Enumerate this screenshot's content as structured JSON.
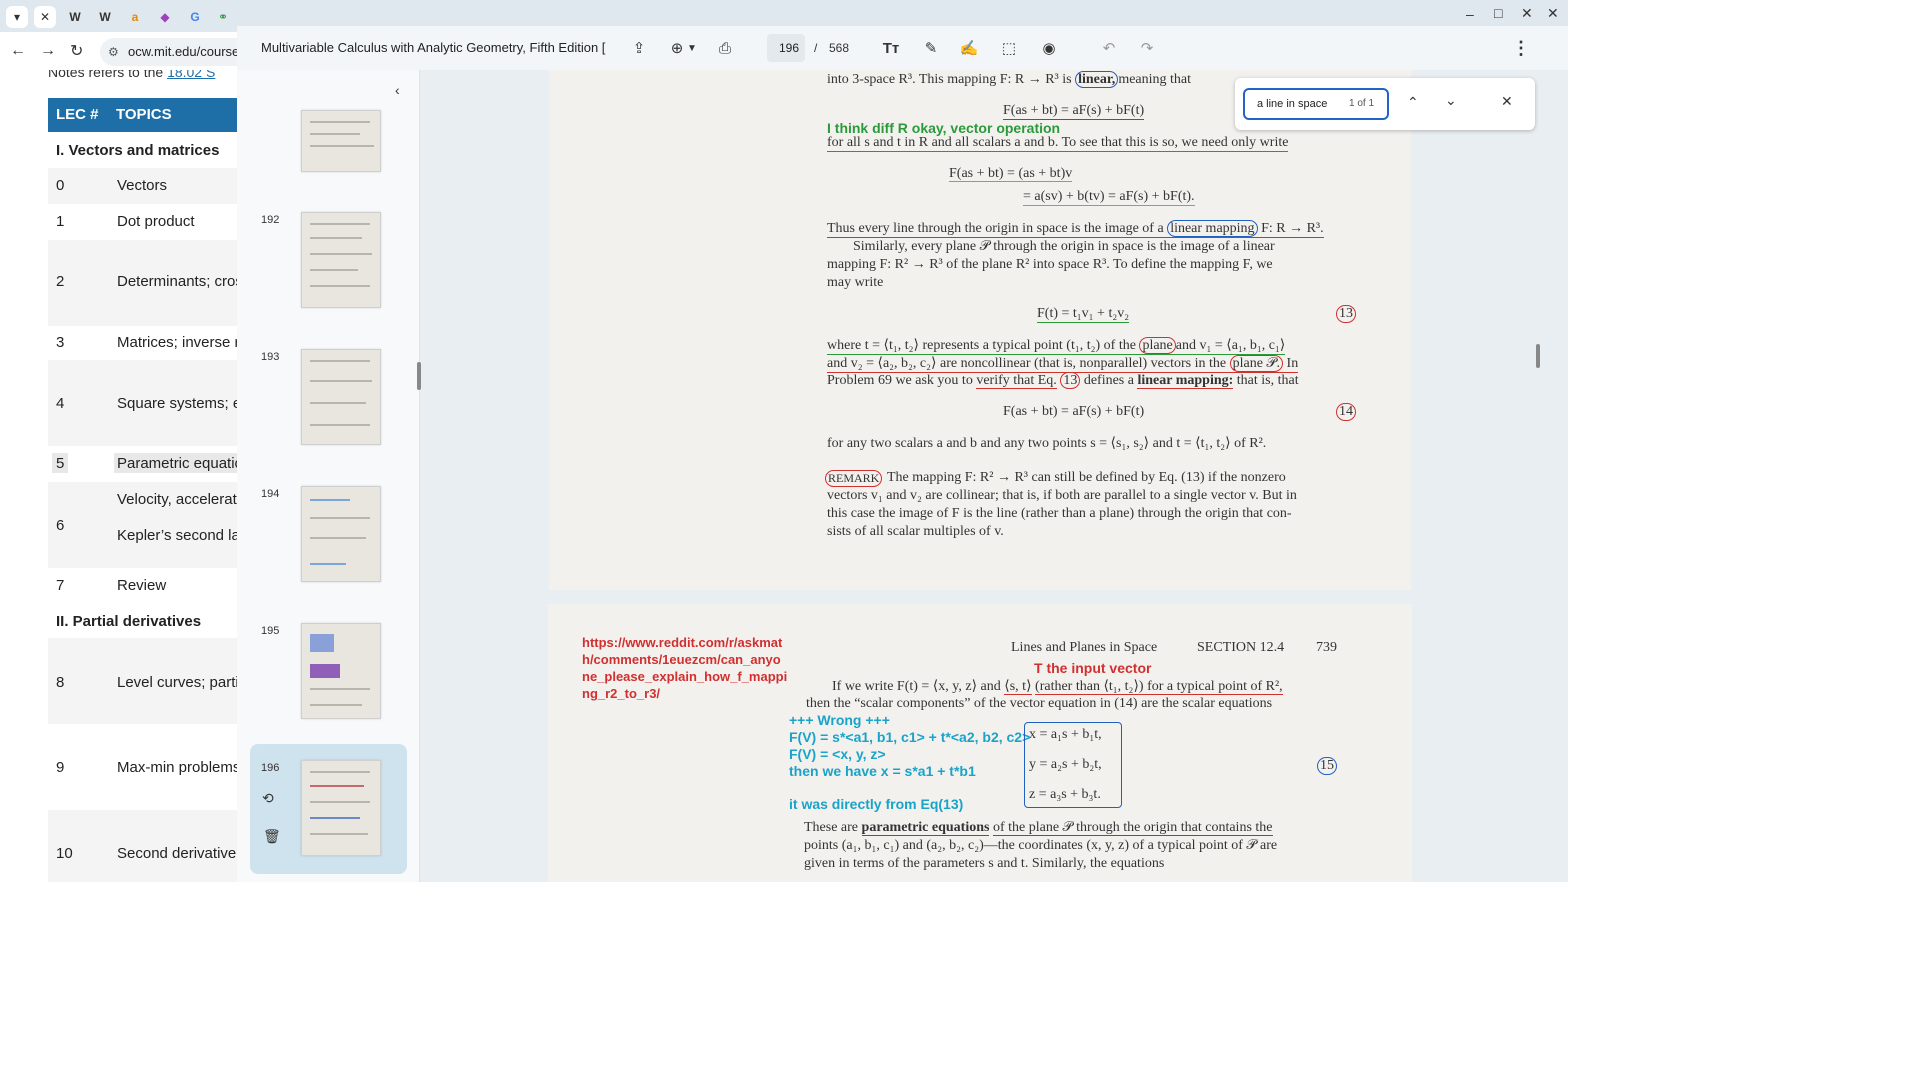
{
  "browser": {
    "tabs": [
      "▾",
      "✕",
      "W",
      "W",
      "a",
      "◆",
      "G",
      "⚭"
    ],
    "url": "ocw.mit.edu/courses...",
    "nav": {
      "back": "←",
      "forward": "→",
      "reload": "↻"
    }
  },
  "window_controls": {
    "min": "–",
    "max": "□",
    "close": "✕"
  },
  "webpage": {
    "note_prefix": "Notes  refers to the",
    "note_link": "18.02 S",
    "table_header": {
      "lec": "LEC #",
      "topics": "TOPICS"
    },
    "sections": [
      "I. Vectors and matrices",
      "II. Partial derivatives"
    ],
    "rows": [
      {
        "num": "0",
        "topic": "Vectors"
      },
      {
        "num": "1",
        "topic": "Dot product"
      },
      {
        "num": "2",
        "topic": "Determinants; cros"
      },
      {
        "num": "3",
        "topic": "Matrices; inverse r"
      },
      {
        "num": "4",
        "topic": "Square systems; e"
      },
      {
        "num": "5",
        "topic": "Parametric equatio"
      },
      {
        "num": "6",
        "topic": "Velocity, accelerati",
        "topic2": "Kepler’s second la"
      },
      {
        "num": "7",
        "topic": "Review"
      },
      {
        "num": "8",
        "topic": "Level curves; parti"
      },
      {
        "num": "9",
        "topic": "Max-min problems"
      },
      {
        "num": "10",
        "topic": "Second derivative"
      }
    ]
  },
  "pdf": {
    "title": "Multivariable Calculus with Analytic Geometry, Fifth Edition [",
    "page_current": "196",
    "page_sep": "/",
    "page_total": "568",
    "thumbnails": [
      "192",
      "193",
      "194",
      "195",
      "196"
    ],
    "find": {
      "query": "a line in space",
      "count": "1 of 1"
    }
  },
  "page1": {
    "l0": "into 3-space R³. This mapping F: R → R³ is",
    "l0_boxed": "linear,",
    "l0_end": "meaning that",
    "eq0": "F(as + bt) = aF(s) + bF(t)",
    "note1": "I think diff R okay, vector operation",
    "l1": "for all s and t in R and all scalars a and b. To see that this is so, we need only write",
    "eq1a": "F(as + bt) = (as + bt)v",
    "eq1b": "= a(sv) + b(tv) = aF(s) + bF(t).",
    "l2a": "Thus every line through the origin in space is the image of a",
    "l2_boxed": "linear mapping",
    "l2b": "F: R → R³.",
    "l3": "Similarly, every plane 𝒫 through the origin in space is the image of a linear",
    "l4": "mapping F: R² → R³ of the plane R² into space R³. To define the mapping F, we",
    "l5": "may write",
    "eq13": "F(t) = t₁v₁ + t₂v₂",
    "eq13_num": "13",
    "l6a": "where t = ⟨t₁, t₂⟩ represents a typical point (t₁, t₂) of the",
    "l6_circ": "plane",
    "l6b": "and v₁ = ⟨a₁, b₁, c₁⟩",
    "l7a": "and v₂ = ⟨a₂, b₂, c₂⟩ are noncollinear (that is, nonparallel) vectors in the",
    "l7_circ": "plane 𝒫.",
    "l7b": "In",
    "l8a": "Problem 69 we ask you to",
    "l8_verify": "verify that Eq.",
    "l8_circ": "13",
    "l8b": "defines a",
    "l8_bold": "linear mapping:",
    "l8c": "that is, that",
    "eq14": "F(as + bt) = aF(s) + bF(t)",
    "eq14_num": "14",
    "l9": "for any two scalars a and b and any two points s = ⟨s₁, s₂⟩ and t = ⟨t₁, t₂⟩ of R².",
    "remark": "REMARK",
    "r1": "The mapping F: R² → R³ can still be defined by Eq. (13) if the nonzero",
    "r2": "vectors v₁ and v₂ are collinear; that is, if both are parallel to a single vector v. But in",
    "r3": "this case the image of F is the line (rather than a plane) through the origin that con-",
    "r4": "sists of all scalar multiples of v."
  },
  "page2": {
    "link": [
      "https://www.reddit.com/r/askmat",
      "h/comments/1euezcm/can_anyo",
      "ne_please_explain_how_f_mappi",
      "ng_r2_to_r3/"
    ],
    "header_title": "Lines and Planes in Space",
    "header_section": "SECTION 12.4",
    "header_page": "739",
    "note_t": "T the input vector",
    "p1a": "If we write F(t) = ⟨x, y, z⟩ and",
    "p1_circ": "⟨s, t⟩",
    "p1b": "(rather than ⟨t₁, t₂⟩) for a typical point of R²,",
    "p2": "then the “scalar components” of the vector equation in (14) are the scalar equations",
    "wrong": [
      "+++ Wrong +++",
      "F(V) = s*<a1, b1, c1> + t*<a2, b2, c2>",
      "F(V) = <x, y, z>",
      "then we have x = s*a1 + t*b1"
    ],
    "eq15": [
      "x = a₁s + b₁t,",
      "y = a₂s + b₂t,",
      "z = a₃s + b₃t."
    ],
    "eq15_num": "15",
    "note_eq13": "it was directly from Eq(13)",
    "p3a": "These are",
    "p3_bold": "parametric equations",
    "p3b": "of the plane 𝒫 through the origin that contains the",
    "p4": "points (a₁, b₁, c₁) and (a₂, b₂, c₂)—the coordinates (x, y, z) of a typical point of 𝒫 are",
    "p5": "given in terms of the parameters s and t. Similarly, the equations"
  },
  "colors": {
    "table_header": "#1e6fa8",
    "accent_blue": "#2563c9",
    "note_green": "#2a9a3a",
    "note_red": "#d03030",
    "note_cyan": "#1aa3c8"
  }
}
